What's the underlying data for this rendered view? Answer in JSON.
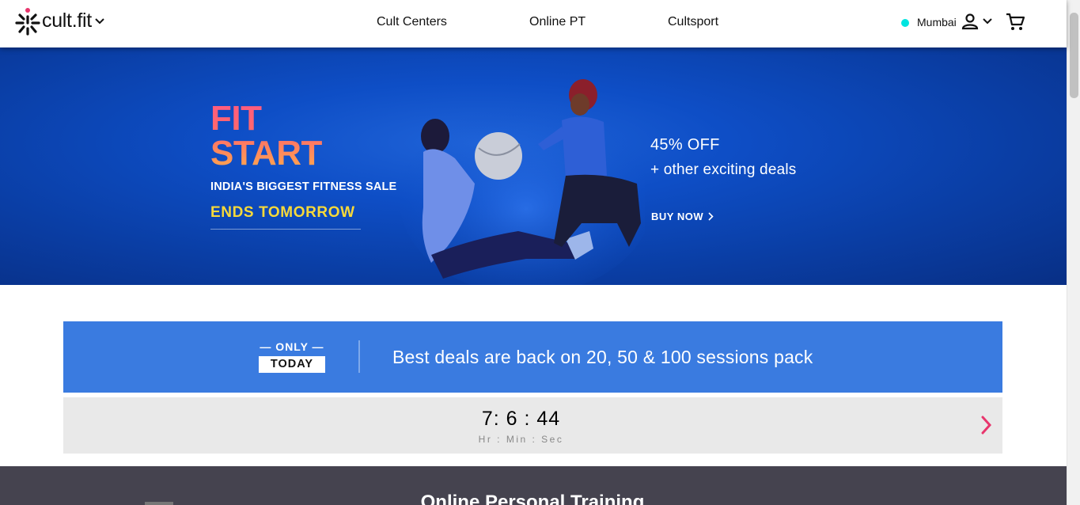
{
  "header": {
    "logo_text": "cult.fit",
    "nav": [
      {
        "label": "Cult Centers"
      },
      {
        "label": "Online PT"
      },
      {
        "label": "Cultsport"
      }
    ],
    "city": "Mumbai",
    "city_dot_color": "#00e5e0"
  },
  "hero": {
    "title_line1": "FIT",
    "title_line2": "START",
    "subtitle": "INDIA'S BIGGEST FITNESS SALE",
    "ends": "ENDS TOMORROW",
    "offer": "45% OFF",
    "offer_sub": "+ other exciting deals",
    "cta": "BUY NOW"
  },
  "deal_banner": {
    "only": "— ONLY —",
    "today": "TODAY",
    "text": "Best deals are back on 20, 50 & 100 sessions pack",
    "color": "#3a7be0"
  },
  "countdown": {
    "value": "7: 6 : 44",
    "labels": "Hr : Min : Sec",
    "arrow_color": "#e8366d"
  },
  "section": {
    "title": "Online Personal Training"
  }
}
